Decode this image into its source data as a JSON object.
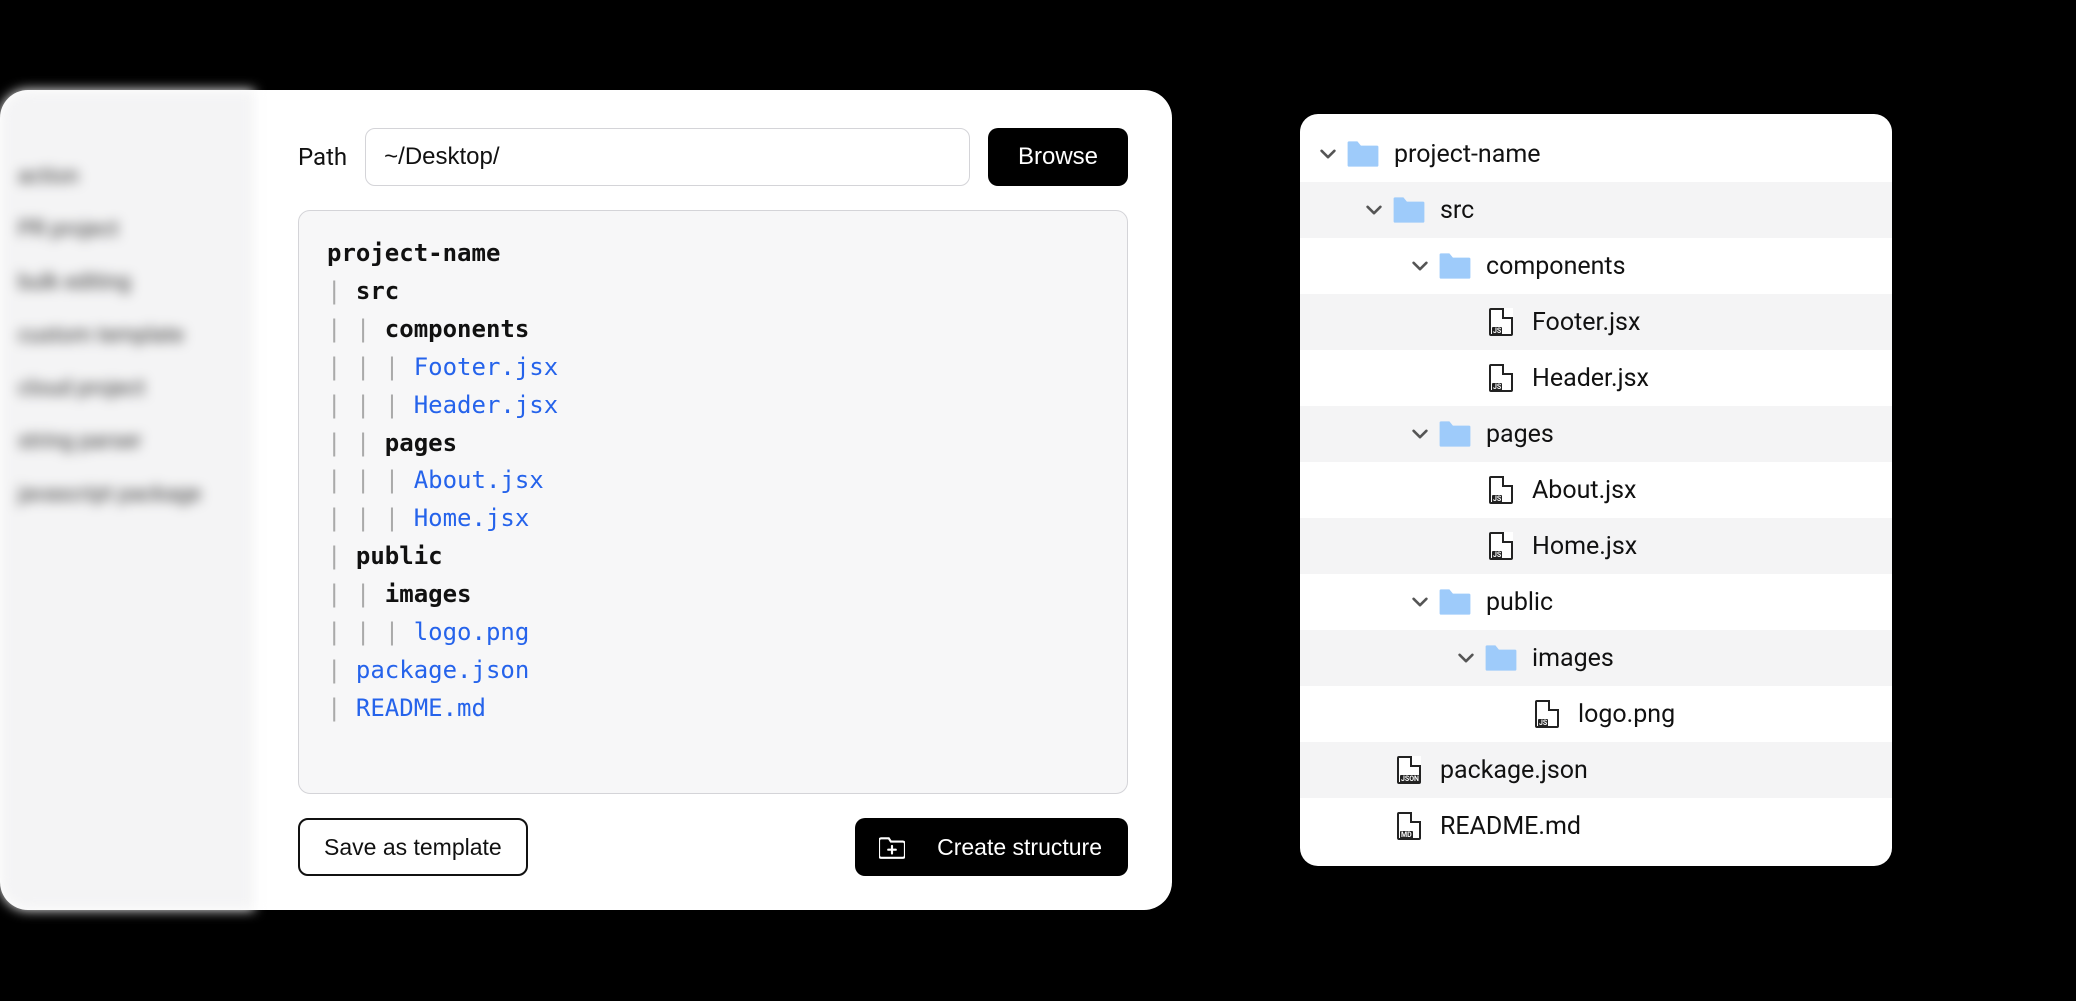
{
  "sidebar": {
    "items": [
      {
        "label": "action"
      },
      {
        "label": "PR project"
      },
      {
        "label": "bulk editing"
      },
      {
        "label": "custom template"
      },
      {
        "label": "cloud project"
      },
      {
        "label": "string parser"
      },
      {
        "label": "javascript package"
      }
    ]
  },
  "form": {
    "path_label": "Path",
    "path_value": "~/Desktop/",
    "browse_label": "Browse",
    "save_label": "Save as template",
    "create_label": "Create structure"
  },
  "text_tree": [
    {
      "prefix": "",
      "text": "project-name",
      "bold": true
    },
    {
      "prefix": "| ",
      "text": "src",
      "bold": true
    },
    {
      "prefix": "| | ",
      "text": "components",
      "bold": true
    },
    {
      "prefix": "| | | ",
      "text": "Footer.jsx",
      "file": true
    },
    {
      "prefix": "| | | ",
      "text": "Header.jsx",
      "file": true
    },
    {
      "prefix": "| | ",
      "text": "pages",
      "bold": true
    },
    {
      "prefix": "| | | ",
      "text": "About.jsx",
      "file": true
    },
    {
      "prefix": "| | | ",
      "text": "Home.jsx",
      "file": true
    },
    {
      "prefix": "| ",
      "text": "public",
      "bold": true
    },
    {
      "prefix": "| | ",
      "text": "images",
      "bold": true
    },
    {
      "prefix": "| | | ",
      "text": "logo.png",
      "file": true
    },
    {
      "prefix": "| ",
      "text": "package.json",
      "file": true
    },
    {
      "prefix": "| ",
      "text": "README.md",
      "file": true
    }
  ],
  "preview_tree": [
    {
      "depth": 0,
      "type": "folder",
      "label": "project-name",
      "chevron": true,
      "alt": false
    },
    {
      "depth": 1,
      "type": "folder",
      "label": "src",
      "chevron": true,
      "alt": true
    },
    {
      "depth": 2,
      "type": "folder",
      "label": "components",
      "chevron": true,
      "alt": false
    },
    {
      "depth": 3,
      "type": "file",
      "badge": "JS",
      "label": "Footer.jsx",
      "alt": true
    },
    {
      "depth": 3,
      "type": "file",
      "badge": "JS",
      "label": "Header.jsx",
      "alt": false
    },
    {
      "depth": 2,
      "type": "folder",
      "label": "pages",
      "chevron": true,
      "alt": true
    },
    {
      "depth": 3,
      "type": "file",
      "badge": "JS",
      "label": "About.jsx",
      "alt": false
    },
    {
      "depth": 3,
      "type": "file",
      "badge": "JS",
      "label": "Home.jsx",
      "alt": true
    },
    {
      "depth": 2,
      "type": "folder",
      "label": "public",
      "chevron": true,
      "alt": false
    },
    {
      "depth": 3,
      "type": "folder",
      "label": "images",
      "chevron": true,
      "alt": true
    },
    {
      "depth": 4,
      "type": "file",
      "badge": "JS",
      "label": "logo.png",
      "alt": false
    },
    {
      "depth": 1,
      "type": "file",
      "badge": "JSON",
      "label": "package.json",
      "alt": true
    },
    {
      "depth": 1,
      "type": "file",
      "badge": "MD",
      "label": "README.md",
      "alt": false
    }
  ]
}
